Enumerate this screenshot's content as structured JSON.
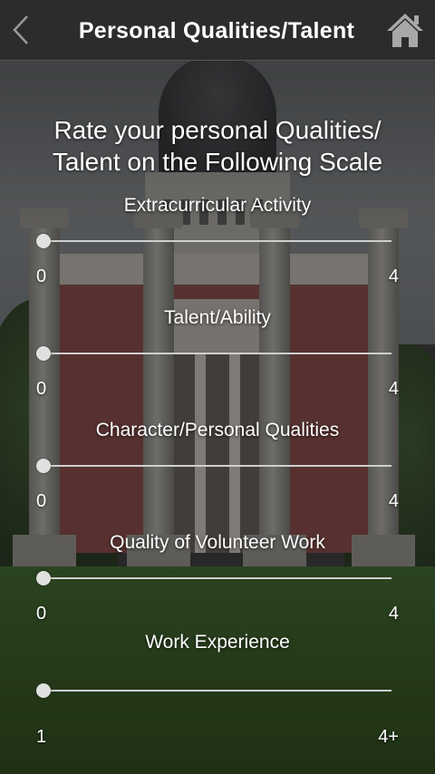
{
  "header": {
    "title": "Personal Qualities/Talent",
    "back_icon": "chevron-left-icon",
    "home_icon": "home-icon"
  },
  "heading": {
    "line1": "Rate your personal Qualities/",
    "line2": "Talent on the Following Scale"
  },
  "sliders": [
    {
      "label": "Extracurricular Activity",
      "min": "0",
      "max": "4",
      "value_fraction": 0
    },
    {
      "label": "Talent/Ability",
      "min": "0",
      "max": "4",
      "value_fraction": 0
    },
    {
      "label": "Character/Personal Qualities",
      "min": "0",
      "max": "4",
      "value_fraction": 0
    },
    {
      "label": "Quality of Volunteer Work",
      "min": "0",
      "max": "4",
      "value_fraction": 0
    },
    {
      "label": "Work Experience",
      "min": "1",
      "max": "4+",
      "value_fraction": 0
    }
  ],
  "colors": {
    "header_bg": "#2c2c2c",
    "track": "#cfcfcf",
    "thumb": "#e0e0e0",
    "text": "#ffffff"
  }
}
